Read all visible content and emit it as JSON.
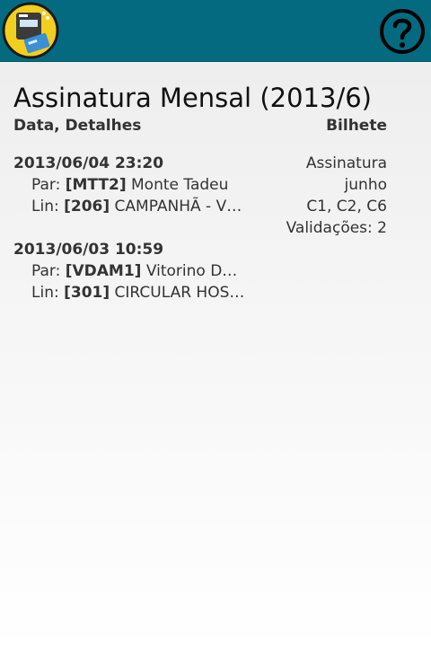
{
  "page": {
    "title": "Assinatura Mensal (2013/6)",
    "col_left": "Data, Detalhes",
    "col_right": "Bilhete"
  },
  "toolbar": {
    "logo_icon": "andante-ticket-logo-icon",
    "help_icon": "help-question-icon"
  },
  "entries": [
    {
      "datetime": "2013/06/04 23:20",
      "stop_label": "Par:",
      "stop_code": "[MTT2]",
      "stop_name": "Monte Tadeu",
      "line_label": "Lin:",
      "line_code": "[206]",
      "line_name": "CAMPANHÃ - V…",
      "ticket_type": "Assinatura",
      "ticket_month": "junho",
      "ticket_zones": "C1, C2, C6",
      "validations": "Validações: 2"
    },
    {
      "datetime": "2013/06/03 10:59",
      "stop_label": "Par:",
      "stop_code": "[VDAM1]",
      "stop_name": "Vitorino D…",
      "line_label": "Lin:",
      "line_code": "[301]",
      "line_name": "CIRCULAR HOS…"
    }
  ]
}
